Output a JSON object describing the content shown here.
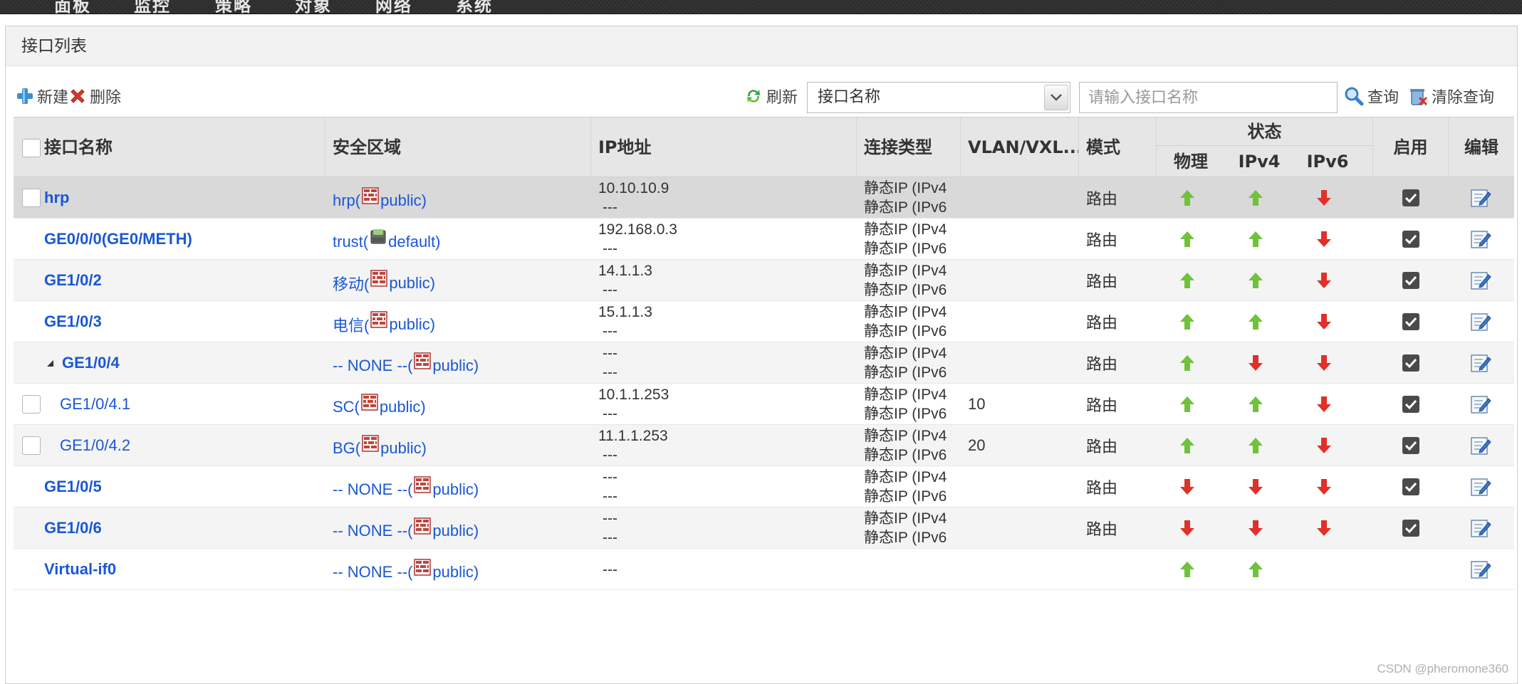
{
  "nav": {
    "items": [
      "面板",
      "监控",
      "策略",
      "对象",
      "网络",
      "系统"
    ]
  },
  "panel": {
    "title": "接口列表"
  },
  "toolbar": {
    "new_label": "新建",
    "delete_label": "删除",
    "refresh_label": "刷新",
    "filter_select_value": "接口名称",
    "search_placeholder": "请输入接口名称",
    "query_label": "查询",
    "clear_label": "清除查询"
  },
  "table": {
    "headers": {
      "name": "接口名称",
      "zone": "安全区域",
      "ip": "IP地址",
      "conn": "连接类型",
      "vlan": "VLAN/VXL...",
      "mode": "模式",
      "status": "状态",
      "physical": "物理",
      "ipv4": "IPv4",
      "ipv6": "IPv6",
      "enable": "启用",
      "edit": "编辑"
    },
    "rows": [
      {
        "name": "hrp",
        "checkbox": true,
        "indent": 0,
        "bold": true,
        "zone_prefix": "hrp(",
        "zone_icon": "firewall-zone-icon",
        "zone_suffix": " public)",
        "ip1": "10.10.10.9",
        "ip2": "---",
        "conn1": "静态IP (IPv4",
        "conn2": "静态IP (IPv6",
        "vlan": "",
        "mode": "路由",
        "phys": "up",
        "v4": "up",
        "v6": "down",
        "enabled": true,
        "style": "sel"
      },
      {
        "name": "GE0/0/0(GE0/METH)",
        "checkbox": false,
        "indent": 0,
        "bold": true,
        "zone_prefix": "trust(",
        "zone_icon": "trust-zone-icon",
        "zone_suffix": " default)",
        "ip1": "192.168.0.3",
        "ip2": "---",
        "conn1": "静态IP (IPv4",
        "conn2": "静态IP (IPv6",
        "vlan": "",
        "mode": "路由",
        "phys": "up",
        "v4": "up",
        "v6": "down",
        "enabled": true,
        "style": ""
      },
      {
        "name": "GE1/0/2",
        "checkbox": false,
        "indent": 0,
        "bold": true,
        "zone_prefix": "移动(",
        "zone_icon": "firewall-zone-icon",
        "zone_suffix": " public)",
        "ip1": "14.1.1.3",
        "ip2": "---",
        "conn1": "静态IP (IPv4",
        "conn2": "静态IP (IPv6",
        "vlan": "",
        "mode": "路由",
        "phys": "up",
        "v4": "up",
        "v6": "down",
        "enabled": true,
        "style": "alt"
      },
      {
        "name": "GE1/0/3",
        "checkbox": false,
        "indent": 0,
        "bold": true,
        "zone_prefix": "电信(",
        "zone_icon": "firewall-zone-icon",
        "zone_suffix": " public)",
        "ip1": "15.1.1.3",
        "ip2": "---",
        "conn1": "静态IP (IPv4",
        "conn2": "静态IP (IPv6",
        "vlan": "",
        "mode": "路由",
        "phys": "up",
        "v4": "up",
        "v6": "down",
        "enabled": true,
        "style": ""
      },
      {
        "name": "GE1/0/4",
        "checkbox": false,
        "indent": 1,
        "bold": true,
        "expander": true,
        "zone_prefix": "-- NONE --(",
        "zone_icon": "firewall-zone-icon",
        "zone_suffix": " public)",
        "ip1": "---",
        "ip2": "---",
        "conn1": "静态IP (IPv4",
        "conn2": "静态IP (IPv6",
        "vlan": "",
        "mode": "路由",
        "phys": "up",
        "v4": "down",
        "v6": "down",
        "enabled": true,
        "style": "alt"
      },
      {
        "name": "GE1/0/4.1",
        "checkbox": true,
        "indent": 2,
        "bold": false,
        "zone_prefix": "SC(",
        "zone_icon": "firewall-zone-icon",
        "zone_suffix": " public)",
        "ip1": "10.1.1.253",
        "ip2": "---",
        "conn1": "静态IP (IPv4",
        "conn2": "静态IP (IPv6",
        "vlan": "10",
        "mode": "路由",
        "phys": "up",
        "v4": "up",
        "v6": "down",
        "enabled": true,
        "style": ""
      },
      {
        "name": "GE1/0/4.2",
        "checkbox": true,
        "indent": 2,
        "bold": false,
        "zone_prefix": "BG(",
        "zone_icon": "firewall-zone-icon",
        "zone_suffix": " public)",
        "ip1": "11.1.1.253",
        "ip2": "---",
        "conn1": "静态IP (IPv4",
        "conn2": "静态IP (IPv6",
        "vlan": "20",
        "mode": "路由",
        "phys": "up",
        "v4": "up",
        "v6": "down",
        "enabled": true,
        "style": "alt"
      },
      {
        "name": "GE1/0/5",
        "checkbox": false,
        "indent": 0,
        "bold": true,
        "zone_prefix": "-- NONE --(",
        "zone_icon": "firewall-zone-icon",
        "zone_suffix": " public)",
        "ip1": "---",
        "ip2": "---",
        "conn1": "静态IP (IPv4",
        "conn2": "静态IP (IPv6",
        "vlan": "",
        "mode": "路由",
        "phys": "down",
        "v4": "down",
        "v6": "down",
        "enabled": true,
        "style": ""
      },
      {
        "name": "GE1/0/6",
        "checkbox": false,
        "indent": 0,
        "bold": true,
        "zone_prefix": "-- NONE --(",
        "zone_icon": "firewall-zone-icon",
        "zone_suffix": " public)",
        "ip1": "---",
        "ip2": "---",
        "conn1": "静态IP (IPv4",
        "conn2": "静态IP (IPv6",
        "vlan": "",
        "mode": "路由",
        "phys": "down",
        "v4": "down",
        "v6": "down",
        "enabled": true,
        "style": "alt"
      },
      {
        "name": "Virtual-if0",
        "checkbox": false,
        "indent": 0,
        "bold": true,
        "zone_prefix": "-- NONE --(",
        "zone_icon": "firewall-zone-icon",
        "zone_suffix": " public)",
        "ip1": "---",
        "ip2": "",
        "conn1": "",
        "conn2": "",
        "vlan": "",
        "mode": "",
        "phys": "up",
        "v4": "up",
        "v6": "",
        "enabled": false,
        "style": ""
      }
    ]
  },
  "colors": {
    "link": "#1a57d6",
    "up": "#6fc23a",
    "down": "#e0302a"
  },
  "watermark": "CSDN @pheromone360"
}
